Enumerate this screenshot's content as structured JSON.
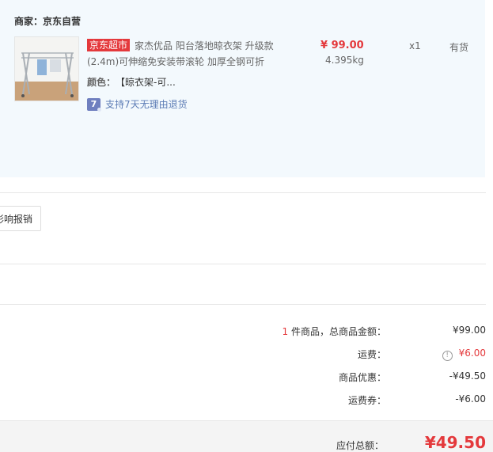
{
  "merchant": {
    "label": "商家：",
    "name": "京东自营"
  },
  "item": {
    "tag": "京东超市",
    "title": "家杰优品 阳台落地晾衣架 升级款(2.4m)可伸缩免安装带滚轮 加厚全钢可折",
    "price": "¥ 99.00",
    "weight": "4.395kg",
    "quantity": "x1",
    "stock": "有货",
    "attribute_label": "颜色：",
    "attribute_value": "【晾衣架-可...",
    "return_icon_text": "7",
    "return_policy": "支持7天无理由退货"
  },
  "invoice_button_label": "影响报销",
  "summary": {
    "item_count": "1",
    "goods_total_label": " 件商品，总商品金额：",
    "goods_total_value": "¥99.00",
    "shipping_label": "运费：",
    "shipping_info_icon": "!",
    "shipping_value": "¥6.00",
    "discount_label": "商品优惠：",
    "discount_value": "-¥49.50",
    "shipping_coupon_label": "运费券：",
    "shipping_coupon_value": "-¥6.00"
  },
  "total": {
    "label": "应付总额：",
    "amount": "¥49.50"
  },
  "colors": {
    "accent_red": "#e4393c",
    "panel_bg": "#f3f9fd",
    "link_blue": "#5c7cb5"
  }
}
